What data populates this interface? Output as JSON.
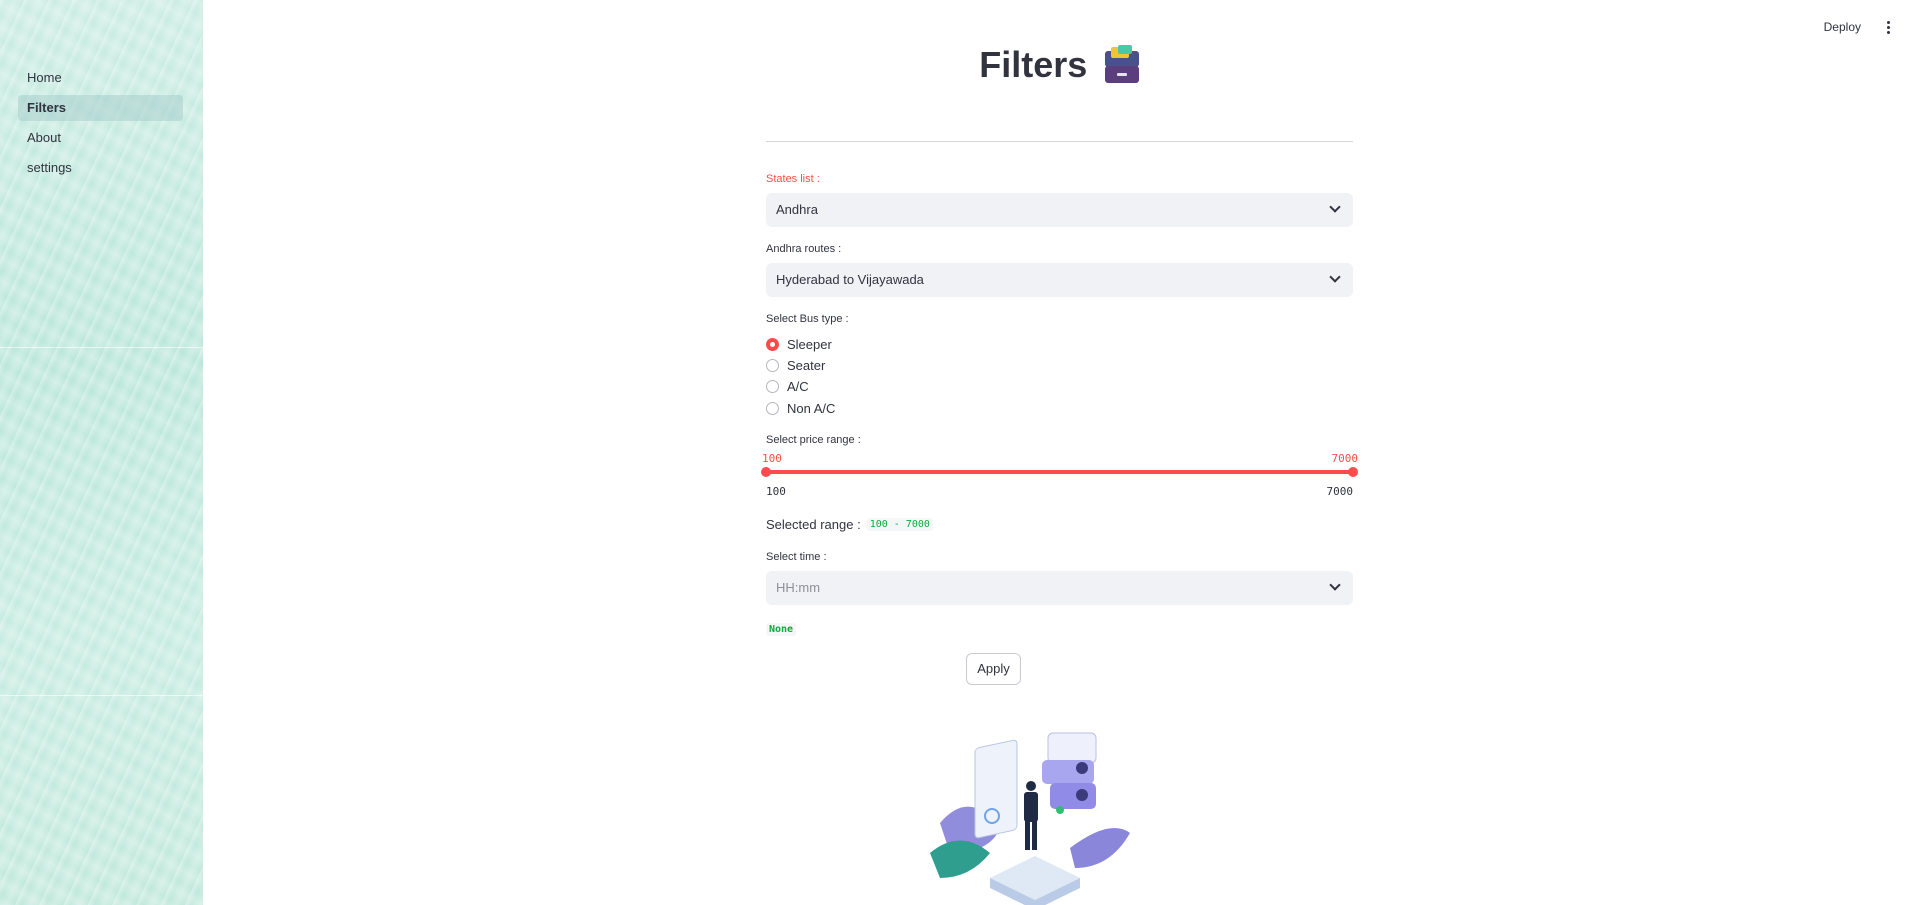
{
  "sidebar": {
    "items": [
      {
        "label": "Home",
        "active": false
      },
      {
        "label": "Filters",
        "active": true
      },
      {
        "label": "About",
        "active": false
      },
      {
        "label": "settings",
        "active": false
      }
    ]
  },
  "header": {
    "deploy_label": "Deploy",
    "menu_icon": "kebab-menu-icon"
  },
  "page": {
    "title": "Filters",
    "title_icon": "card-file-box-icon"
  },
  "form": {
    "states": {
      "label": "States list :",
      "value": "Andhra"
    },
    "routes": {
      "label": "Andhra routes :",
      "value": "Hyderabad to Vijayawada"
    },
    "bus_type": {
      "label": "Select Bus type :",
      "options": [
        "Sleeper",
        "Seater",
        "A/C",
        "Non A/C"
      ],
      "selected": "Sleeper"
    },
    "price": {
      "label": "Select price range :",
      "low": "100",
      "high": "7000",
      "min": "100",
      "max": "7000"
    },
    "selected_range": {
      "label": "Selected range :",
      "value": "100 - 7000"
    },
    "time": {
      "label": "Select time :",
      "placeholder": "HH:mm"
    },
    "time_output": "None",
    "apply_label": "Apply"
  },
  "colors": {
    "accent": "#ff4b4b",
    "code_green": "#09ab3b",
    "input_bg": "#f0f2f6",
    "sidebar_bg": "#c0e9dc"
  }
}
